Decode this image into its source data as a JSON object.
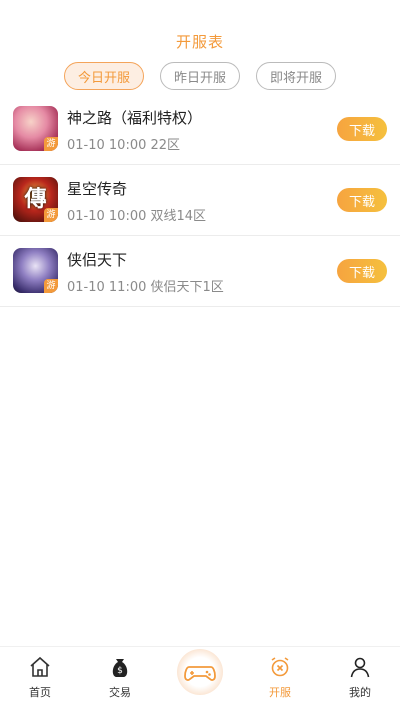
{
  "header": {
    "title": "开服表"
  },
  "tabs": [
    {
      "label": "今日开服",
      "active": true
    },
    {
      "label": "昨日开服",
      "active": false
    },
    {
      "label": "即将开服",
      "active": false
    }
  ],
  "games": [
    {
      "name": "神之路（福利特权）",
      "time": "01-10 10:00",
      "server": "22区",
      "download_label": "下载",
      "icon": "game-icon-shenzhilu",
      "corner": "游"
    },
    {
      "name": "星空传奇",
      "time": "01-10 10:00",
      "server": "双线14区",
      "download_label": "下载",
      "icon": "game-icon-xingkong",
      "corner": "游",
      "glyph": "傳"
    },
    {
      "name": "侠侣天下",
      "time": "01-10 11:00",
      "server": "侠侣天下1区",
      "download_label": "下载",
      "icon": "game-icon-xialv",
      "corner": "游"
    }
  ],
  "tabbar": [
    {
      "label": "首页",
      "icon": "home-icon",
      "active": false
    },
    {
      "label": "交易",
      "icon": "money-bag-icon",
      "active": false
    },
    {
      "label": "",
      "icon": "gamepad-icon",
      "active": false
    },
    {
      "label": "开服",
      "icon": "alarm-clock-icon",
      "active": true
    },
    {
      "label": "我的",
      "icon": "user-icon",
      "active": false
    }
  ],
  "colors": {
    "accent": "#f39a3b",
    "muted": "#8a8a8a",
    "divider": "#ececec"
  }
}
